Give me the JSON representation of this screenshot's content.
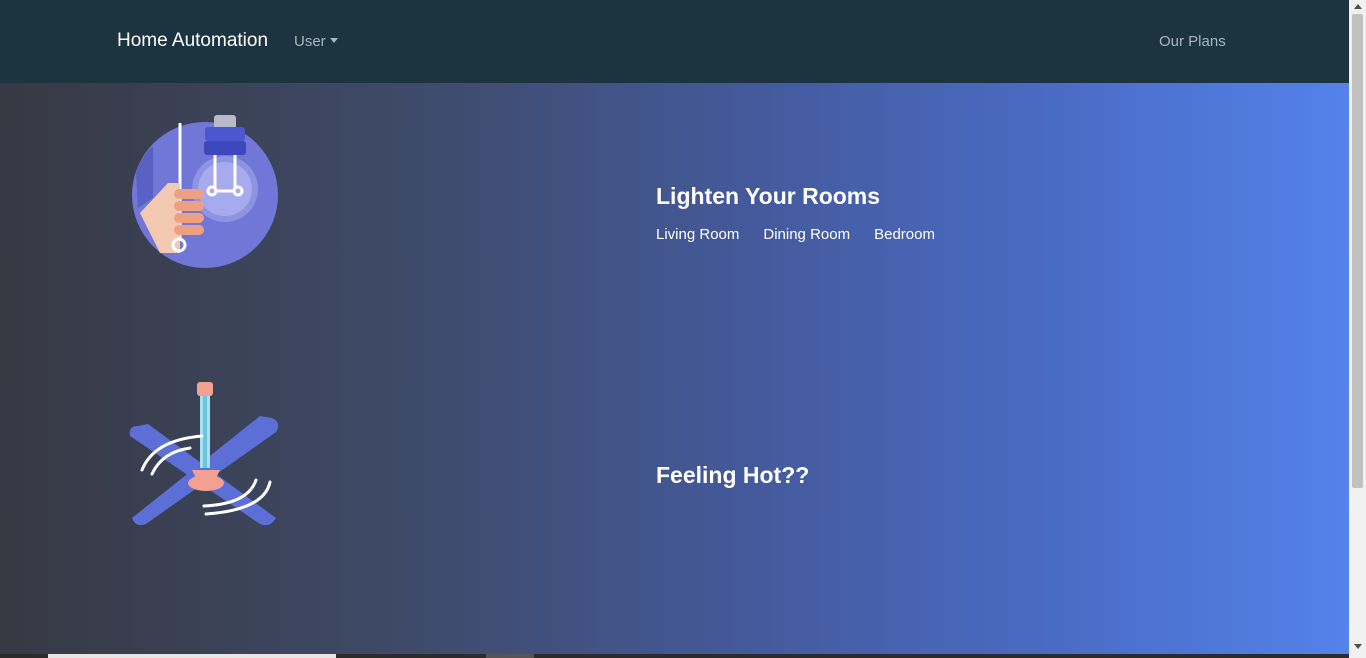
{
  "navbar": {
    "brand": "Home Automation",
    "user_menu": "User",
    "plans_link": "Our Plans"
  },
  "sections": [
    {
      "title": "Lighten Your Rooms",
      "icon": "light-bulb-illustration",
      "rooms": [
        "Living Room",
        "Dining Room",
        "Bedroom"
      ]
    },
    {
      "title": "Feeling Hot??",
      "icon": "ceiling-fan-illustration"
    }
  ],
  "colors": {
    "navbar_bg": "#1b3440",
    "gradient_start": "#373943",
    "gradient_end": "#5482ea",
    "text": "#ffffff",
    "nav_muted": "#aab6bd"
  }
}
